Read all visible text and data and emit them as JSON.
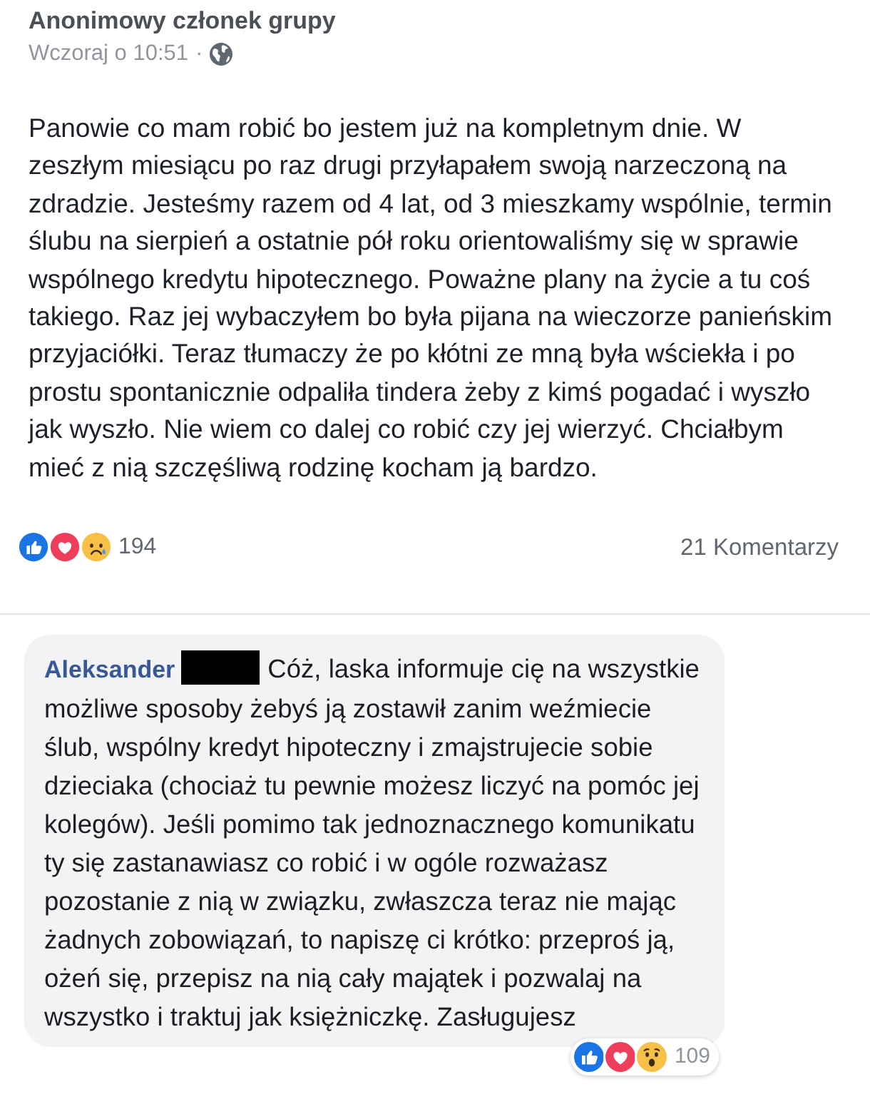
{
  "post": {
    "author": "Anonimowy członek grupy",
    "timestamp": "Wczoraj o 10:51",
    "separator": "·",
    "text": "Panowie co mam robić bo jestem już na kompletnym dnie. W zeszłym miesiącu po raz drugi przyłapałem swoją narzeczoną na zdradzie. Jesteśmy razem od 4 lat, od 3 mieszkamy wspólnie, termin ślubu na sierpień a ostatnie pół roku orientowaliśmy się w sprawie wspólnego kredytu hipotecznego. Poważne plany na życie a tu coś takiego. Raz jej wybaczyłem bo była pijana na wieczorze panieńskim przyjaciółki. Teraz tłumaczy że po kłótni ze mną była wściekła i po prostu spontanicznie odpaliła tindera żeby z kimś pogadać i wyszło jak wyszło. Nie wiem co dalej co robić czy jej wierzyć. Chciałbym mieć z nią szczęśliwą rodzinę kocham ją bardzo.",
    "reactions": [
      {
        "kind": "like"
      },
      {
        "kind": "love"
      },
      {
        "kind": "sad"
      }
    ],
    "reaction_count": "194",
    "comments_count": "21 Komentarzy"
  },
  "comment": {
    "author": "Aleksander",
    "author_redacted": true,
    "text": "Cóż, laska informuje cię na wszystkie możliwe sposoby żebyś ją zostawił zanim weźmiecie ślub, wspólny kredyt hipoteczny i zmajstrujecie sobie dzieciaka (chociaż tu pewnie możesz liczyć na pomóc jej kolegów). Jeśli pomimo tak jednoznacznego komunikatu ty się zastanawiasz co robić i w ogóle rozważasz pozostanie z nią w związku, zwłaszcza teraz nie mając żadnych zobowiązań, to napiszę ci krótko: przeproś ją, ożeń się, przepisz na nią cały majątek i pozwalaj na wszystko i traktuj jak księżniczkę. Zasługujesz",
    "reactions": [
      {
        "kind": "like"
      },
      {
        "kind": "love"
      },
      {
        "kind": "wow"
      }
    ],
    "reaction_count": "109"
  }
}
